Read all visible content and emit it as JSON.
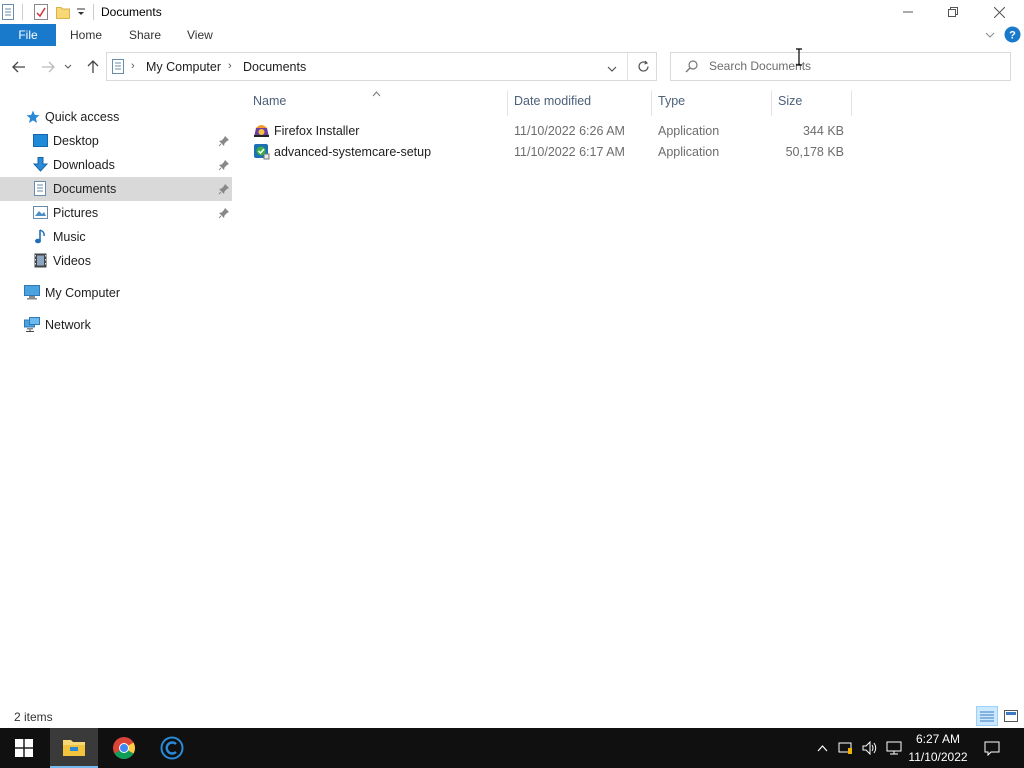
{
  "window": {
    "title": "Documents"
  },
  "ribbon": {
    "tabs": [
      "File",
      "Home",
      "Share",
      "View"
    ]
  },
  "address": {
    "crumbs": [
      "My Computer",
      "Documents"
    ]
  },
  "search": {
    "placeholder": "Search Documents"
  },
  "sidebar": {
    "quick_access": "Quick access",
    "items": [
      {
        "label": "Desktop",
        "icon": "desktop-icon",
        "pinned": true
      },
      {
        "label": "Downloads",
        "icon": "downloads-icon",
        "pinned": true
      },
      {
        "label": "Documents",
        "icon": "documents-icon",
        "pinned": true,
        "selected": true
      },
      {
        "label": "Pictures",
        "icon": "pictures-icon",
        "pinned": true
      },
      {
        "label": "Music",
        "icon": "music-icon",
        "pinned": false
      },
      {
        "label": "Videos",
        "icon": "videos-icon",
        "pinned": false
      }
    ],
    "my_computer": "My Computer",
    "network": "Network"
  },
  "file_list": {
    "columns": [
      "Name",
      "Date modified",
      "Type",
      "Size"
    ],
    "rows": [
      {
        "name": "Firefox Installer",
        "date": "11/10/2022 6:26 AM",
        "type": "Application",
        "size": "344 KB",
        "icon": "firefox-installer-icon"
      },
      {
        "name": "advanced-systemcare-setup",
        "date": "11/10/2022 6:17 AM",
        "type": "Application",
        "size": "50,178 KB",
        "icon": "systemcare-setup-icon"
      }
    ]
  },
  "status": {
    "item_count": "2 items"
  },
  "taskbar": {
    "time": "6:27 AM",
    "date": "11/10/2022"
  },
  "colors": {
    "accent": "#1979ca",
    "selection": "#d9d9d9",
    "taskbar": "#101010"
  }
}
